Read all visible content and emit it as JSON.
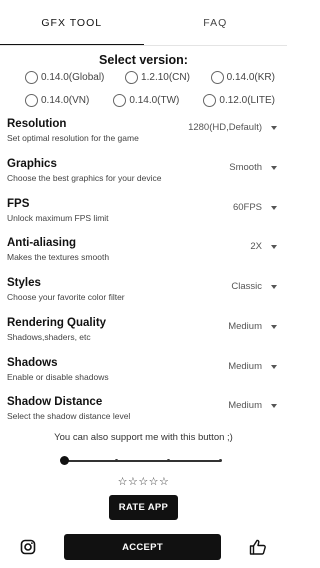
{
  "tabs": [
    {
      "label": "GFX TOOL",
      "active": true
    },
    {
      "label": "FAQ",
      "active": false
    }
  ],
  "version": {
    "title": "Select version:",
    "options": [
      "0.14.0(Global)",
      "1.2.10(CN)",
      "0.14.0(KR)",
      "0.14.0(VN)",
      "0.14.0(TW)",
      "0.12.0(LITE)"
    ],
    "selected": null
  },
  "settings": [
    {
      "title": "Resolution",
      "desc": "Set optimal resolution for the game",
      "value": "1280(HD,Default)"
    },
    {
      "title": "Graphics",
      "desc": "Choose the best graphics for your device",
      "value": "Smooth"
    },
    {
      "title": "FPS",
      "desc": "Unlock maximum FPS limit",
      "value": "60FPS"
    },
    {
      "title": "Anti-aliasing",
      "desc": "Makes the textures smooth",
      "value": "2X"
    },
    {
      "title": "Styles",
      "desc": "Choose your favorite color filter",
      "value": "Classic"
    },
    {
      "title": "Rendering Quality",
      "desc": "Shadows,shaders, etc",
      "value": "Medium"
    },
    {
      "title": "Shadows",
      "desc": "Enable or disable shadows",
      "value": "Medium"
    },
    {
      "title": "Shadow Distance",
      "desc": "Select the shadow distance level",
      "value": "Medium"
    }
  ],
  "support": {
    "text": "You can also support me with this button ;)",
    "slider_level": 0,
    "slider_steps": 4,
    "stars": "☆☆☆☆☆"
  },
  "buttons": {
    "rate_app": "RATE APP",
    "accept": "ACCEPT"
  },
  "icons": {
    "instagram": "instagram-icon",
    "like": "thumbs-up-icon"
  },
  "colors": {
    "accent": "#111111",
    "background": "#ffffff"
  }
}
